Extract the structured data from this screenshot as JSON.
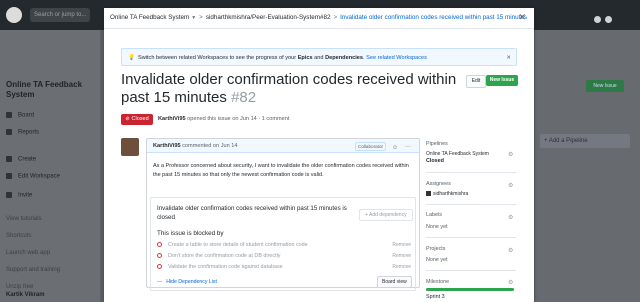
{
  "github": {
    "search_placeholder": "Search or jump to..."
  },
  "sidebar": {
    "title": "Online TA Feedback System",
    "items": [
      {
        "label": "Board",
        "icon": "board-icon"
      },
      {
        "label": "Reports",
        "icon": "reports-icon"
      },
      {
        "label": "Create",
        "icon": "create-icon"
      },
      {
        "label": "Edit Workspace",
        "icon": "edit-icon"
      },
      {
        "label": "Invite",
        "icon": "invite-icon"
      }
    ],
    "muted": [
      "View tutorials",
      "Shortcuts",
      "Launch web app",
      "Support and training",
      "Unzip free"
    ],
    "user": "Kartik Vikram"
  },
  "background_board": {
    "new_issue": "New Issue",
    "add_pipeline": "+ Add a Pipeline"
  },
  "modal": {
    "breadcrumb": {
      "workspace": "Online TA Feedback System",
      "repo": "sidharthkmishra/Peer-Evaluation-System#82",
      "issue": "Invalidate older confirmation codes received within past 15 minutes"
    },
    "banner": {
      "text_1": "Switch between related Workspaces to see the progress of your ",
      "text_2": "Epics",
      "text_3": " and ",
      "text_4": "Dependencies",
      "text_5": ". ",
      "link": "See related Workspaces"
    },
    "title": "Invalidate older confirmation codes received within past 15 minutes",
    "number": "#82",
    "edit_label": "Edit",
    "new_issue_label": "New Issue",
    "status": "Closed",
    "opened_user": "KarthiVi95",
    "opened_rest": " opened this issue on Jun 14 · 1 comment",
    "comment": {
      "author": "KarthiVi95",
      "meta": " commented on Jun 14",
      "badge": "Collaborator",
      "body": "As a Professor concerned about security, I want to invalidate the older confirmation codes received within the past 15 minutes so that only the newest confirmation code is valid."
    },
    "dependency": {
      "title_prefix": "Invalidate older confirmation codes received within past 15 minutes",
      "title_suffix": " is closed",
      "add_label": "+ Add dependency",
      "blocked_label": "This issue is blocked by",
      "blockers": [
        "Create a table to store details of student confirmation code",
        "Don't store the confirmation code at DB directly",
        "Validate the confirmation code against database"
      ],
      "remove_label": "Remove",
      "hide_label": "Hide Dependency List",
      "board_view_label": "Board view"
    },
    "right_sidebar": {
      "pipelines_label": "Pipelines",
      "pipeline_name": "Online TA Feedback System",
      "pipeline_status": "Closed",
      "assignees_label": "Assignees",
      "assignee": "sidharthkmishra",
      "labels_label": "Labels",
      "labels_value": "None yet",
      "projects_label": "Projects",
      "projects_value": "None yet",
      "milestone_label": "Milestone",
      "milestone_value": "Sprint 3",
      "milestone_progress": 1.0
    }
  }
}
